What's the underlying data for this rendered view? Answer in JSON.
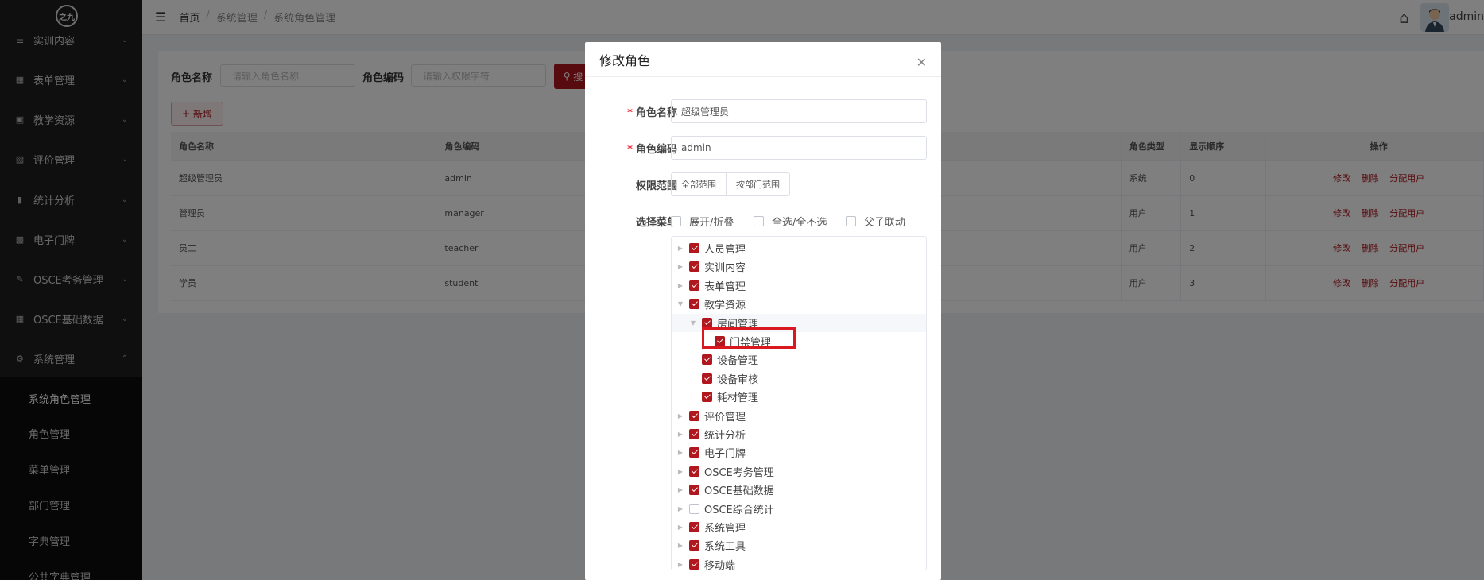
{
  "sidebar": {
    "logo_text": "之九",
    "items": [
      {
        "label": "实训内容",
        "icon": "book-icon"
      },
      {
        "label": "表单管理",
        "icon": "form-icon"
      },
      {
        "label": "教学资源",
        "icon": "folder-icon"
      },
      {
        "label": "评价管理",
        "icon": "evaluation-icon"
      },
      {
        "label": "统计分析",
        "icon": "bar-chart-icon"
      },
      {
        "label": "电子门牌",
        "icon": "monitor-icon"
      },
      {
        "label": "OSCE考务管理",
        "icon": "exam-icon"
      },
      {
        "label": "OSCE基础数据",
        "icon": "grid-icon"
      },
      {
        "label": "系统管理",
        "icon": "gear-icon"
      }
    ],
    "sub_items": [
      {
        "label": "系统角色管理",
        "active": true
      },
      {
        "label": "角色管理"
      },
      {
        "label": "菜单管理"
      },
      {
        "label": "部门管理"
      },
      {
        "label": "字典管理"
      },
      {
        "label": "公共字典管理"
      }
    ]
  },
  "header": {
    "breadcrumb": [
      "首页",
      "系统管理",
      "系统角色管理"
    ],
    "user_name": "admin"
  },
  "filter": {
    "role_name_label": "角色名称",
    "role_name_placeholder": "请输入角色名称",
    "role_code_label": "角色编码",
    "role_code_placeholder": "请输入权限字符",
    "search_label": "搜",
    "add_label": "新增"
  },
  "table": {
    "headers": [
      "角色名称",
      "角色编码",
      "",
      "角色类型",
      "显示顺序",
      "操作"
    ],
    "rows": [
      [
        "超级管理员",
        "admin",
        "",
        "系统",
        "0"
      ],
      [
        "管理员",
        "manager",
        "",
        "用户",
        "1"
      ],
      [
        "员工",
        "teacher",
        "",
        "用户",
        "2"
      ],
      [
        "学员",
        "student",
        "",
        "用户",
        "3"
      ]
    ],
    "ops": [
      "修改",
      "删除",
      "分配用户"
    ]
  },
  "dialog": {
    "title": "修改角色",
    "role_name_label": "角色名称",
    "role_name_value": "超级管理员",
    "role_code_label": "角色编码",
    "role_code_value": "admin",
    "scope_label": "权限范围",
    "scope_options": [
      "全部范围",
      "按部门范围"
    ],
    "menu_label": "选择菜单",
    "menu_opts": [
      "展开/折叠",
      "全选/全不选",
      "父子联动"
    ],
    "tree": [
      {
        "label": "人员管理",
        "level": 0,
        "checked": true,
        "arrow": "right"
      },
      {
        "label": "实训内容",
        "level": 0,
        "checked": true,
        "arrow": "right"
      },
      {
        "label": "表单管理",
        "level": 0,
        "checked": true,
        "arrow": "right"
      },
      {
        "label": "教学资源",
        "level": 0,
        "checked": true,
        "arrow": "down"
      },
      {
        "label": "房间管理",
        "level": 1,
        "checked": true,
        "arrow": "down",
        "hl": true
      },
      {
        "label": "门禁管理",
        "level": 2,
        "checked": true,
        "arrow": ""
      },
      {
        "label": "设备管理",
        "level": 1,
        "checked": true,
        "arrow": ""
      },
      {
        "label": "设备审核",
        "level": 1,
        "checked": true,
        "arrow": ""
      },
      {
        "label": "耗材管理",
        "level": 1,
        "checked": true,
        "arrow": ""
      },
      {
        "label": "评价管理",
        "level": 0,
        "checked": true,
        "arrow": "right"
      },
      {
        "label": "统计分析",
        "level": 0,
        "checked": true,
        "arrow": "right"
      },
      {
        "label": "电子门牌",
        "level": 0,
        "checked": true,
        "arrow": "right"
      },
      {
        "label": "OSCE考务管理",
        "level": 0,
        "checked": true,
        "arrow": "right"
      },
      {
        "label": "OSCE基础数据",
        "level": 0,
        "checked": true,
        "arrow": "right"
      },
      {
        "label": "OSCE综合统计",
        "level": 0,
        "checked": false,
        "arrow": "right"
      },
      {
        "label": "系统管理",
        "level": 0,
        "checked": true,
        "arrow": "right"
      },
      {
        "label": "系统工具",
        "level": 0,
        "checked": true,
        "arrow": "right"
      },
      {
        "label": "移动端",
        "level": 0,
        "checked": true,
        "arrow": "right"
      }
    ]
  },
  "colors": {
    "primary": "#b0171f",
    "highlight_box": "#d9191f",
    "sidebar_bg": "#1f1f1f"
  }
}
